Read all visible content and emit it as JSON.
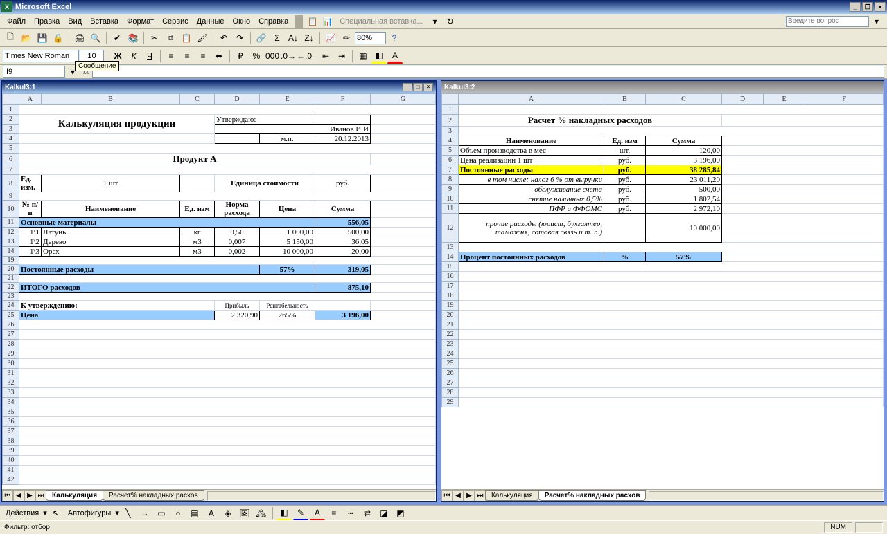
{
  "app": {
    "title": "Microsoft Excel"
  },
  "menu": [
    "Файл",
    "Правка",
    "Вид",
    "Вставка",
    "Формат",
    "Сервис",
    "Данные",
    "Окно",
    "Справка"
  ],
  "special_paste": "Специальная вставка...",
  "question_placeholder": "Введите вопрос",
  "font": {
    "name": "Times New Roman",
    "size": "10"
  },
  "zoom": "80%",
  "tooltip": "Сообщение",
  "name_box": "I9",
  "win1": {
    "title": "Kalkul3:1",
    "cols": [
      "A",
      "B",
      "C",
      "D",
      "E",
      "F",
      "G"
    ],
    "title_text": "Калькуляция продукции",
    "approve": "Утверждаю:",
    "approver": "Иванов И.И",
    "mp": "м.п.",
    "date": "20.12.2013",
    "product": "Продукт А",
    "unit_lbl": "Ед. изм.",
    "unit_val": "1 шт",
    "unit_cost": "Единица стоимости",
    "unit_cost_val": "руб.",
    "hdr": {
      "num": "№ п/п",
      "name": "Наименование",
      "ed": "Ед. изм",
      "norm": "Норма расхода",
      "price": "Цена",
      "sum": "Сумма"
    },
    "materials": "Основные материалы",
    "materials_sum": "556,05",
    "rows": [
      {
        "n": "1\\1",
        "name": "Латунь",
        "ed": "кг",
        "norm": "0,50",
        "price": "1 000,00",
        "sum": "500,00"
      },
      {
        "n": "1\\2",
        "name": "Дерево",
        "ed": "м3",
        "norm": "0,007",
        "price": "5 150,00",
        "sum": "36,05"
      },
      {
        "n": "1\\3",
        "name": "Орех",
        "ed": "м3",
        "norm": "0,002",
        "price": "10 000,00",
        "sum": "20,00"
      }
    ],
    "const_exp": "Постоянные расходы",
    "const_pct": "57%",
    "const_sum": "319,05",
    "itogo": "ИТОГО расходов",
    "itogo_sum": "875,10",
    "to_approve": "К утверждению:",
    "profit": "Прибыль",
    "rent": "Рентабельность",
    "price_lbl": "Цена",
    "price_val": "2 320,90",
    "rent_val": "265%",
    "price_sum": "3 196,00",
    "tabs": [
      "Калькуляция",
      "Расчет% накладных расхов"
    ]
  },
  "win2": {
    "title": "Kalkul3:2",
    "cols": [
      "A",
      "B",
      "C",
      "D",
      "E",
      "F"
    ],
    "title_text": "Расчет % накладных расходов",
    "hdr": {
      "name": "Наименование",
      "ed": "Ед. изм",
      "sum": "Сумма"
    },
    "rows": [
      {
        "name": "Объем производства в мес",
        "ed": "шт.",
        "sum": "120,00"
      },
      {
        "name": "Цена реализации 1 шт",
        "ed": "руб.",
        "sum": "3 196,00"
      }
    ],
    "const_row": {
      "name": "Постоянные расходы",
      "ed": "руб.",
      "sum": "38 285,84"
    },
    "details": [
      {
        "name": "в том числе: налог 6 % от выручки",
        "ed": "руб.",
        "sum": "23 011,20"
      },
      {
        "name": "обслуживание счета",
        "ed": "руб.",
        "sum": "500,00"
      },
      {
        "name": "снятие наличных 0,5%",
        "ed": "руб.",
        "sum": "1 802,54"
      },
      {
        "name": "ПФР и ФФОМС",
        "ed": "руб.",
        "sum": "2 972,10"
      },
      {
        "name": "прочие расходы (юрист, бухгалтер, таможня, сотовая связь и т. п.)",
        "ed": "",
        "sum": "10 000,00"
      }
    ],
    "pct_row": {
      "name": "Процент постоянных расходов",
      "ed": "%",
      "sum": "57%"
    },
    "tabs": [
      "Калькуляция",
      "Расчет% накладных расхов"
    ]
  },
  "drawbar": {
    "actions": "Действия",
    "autoshapes": "Автофигуры"
  },
  "status": {
    "filter": "Фильтр: отбор",
    "num": "NUM"
  }
}
